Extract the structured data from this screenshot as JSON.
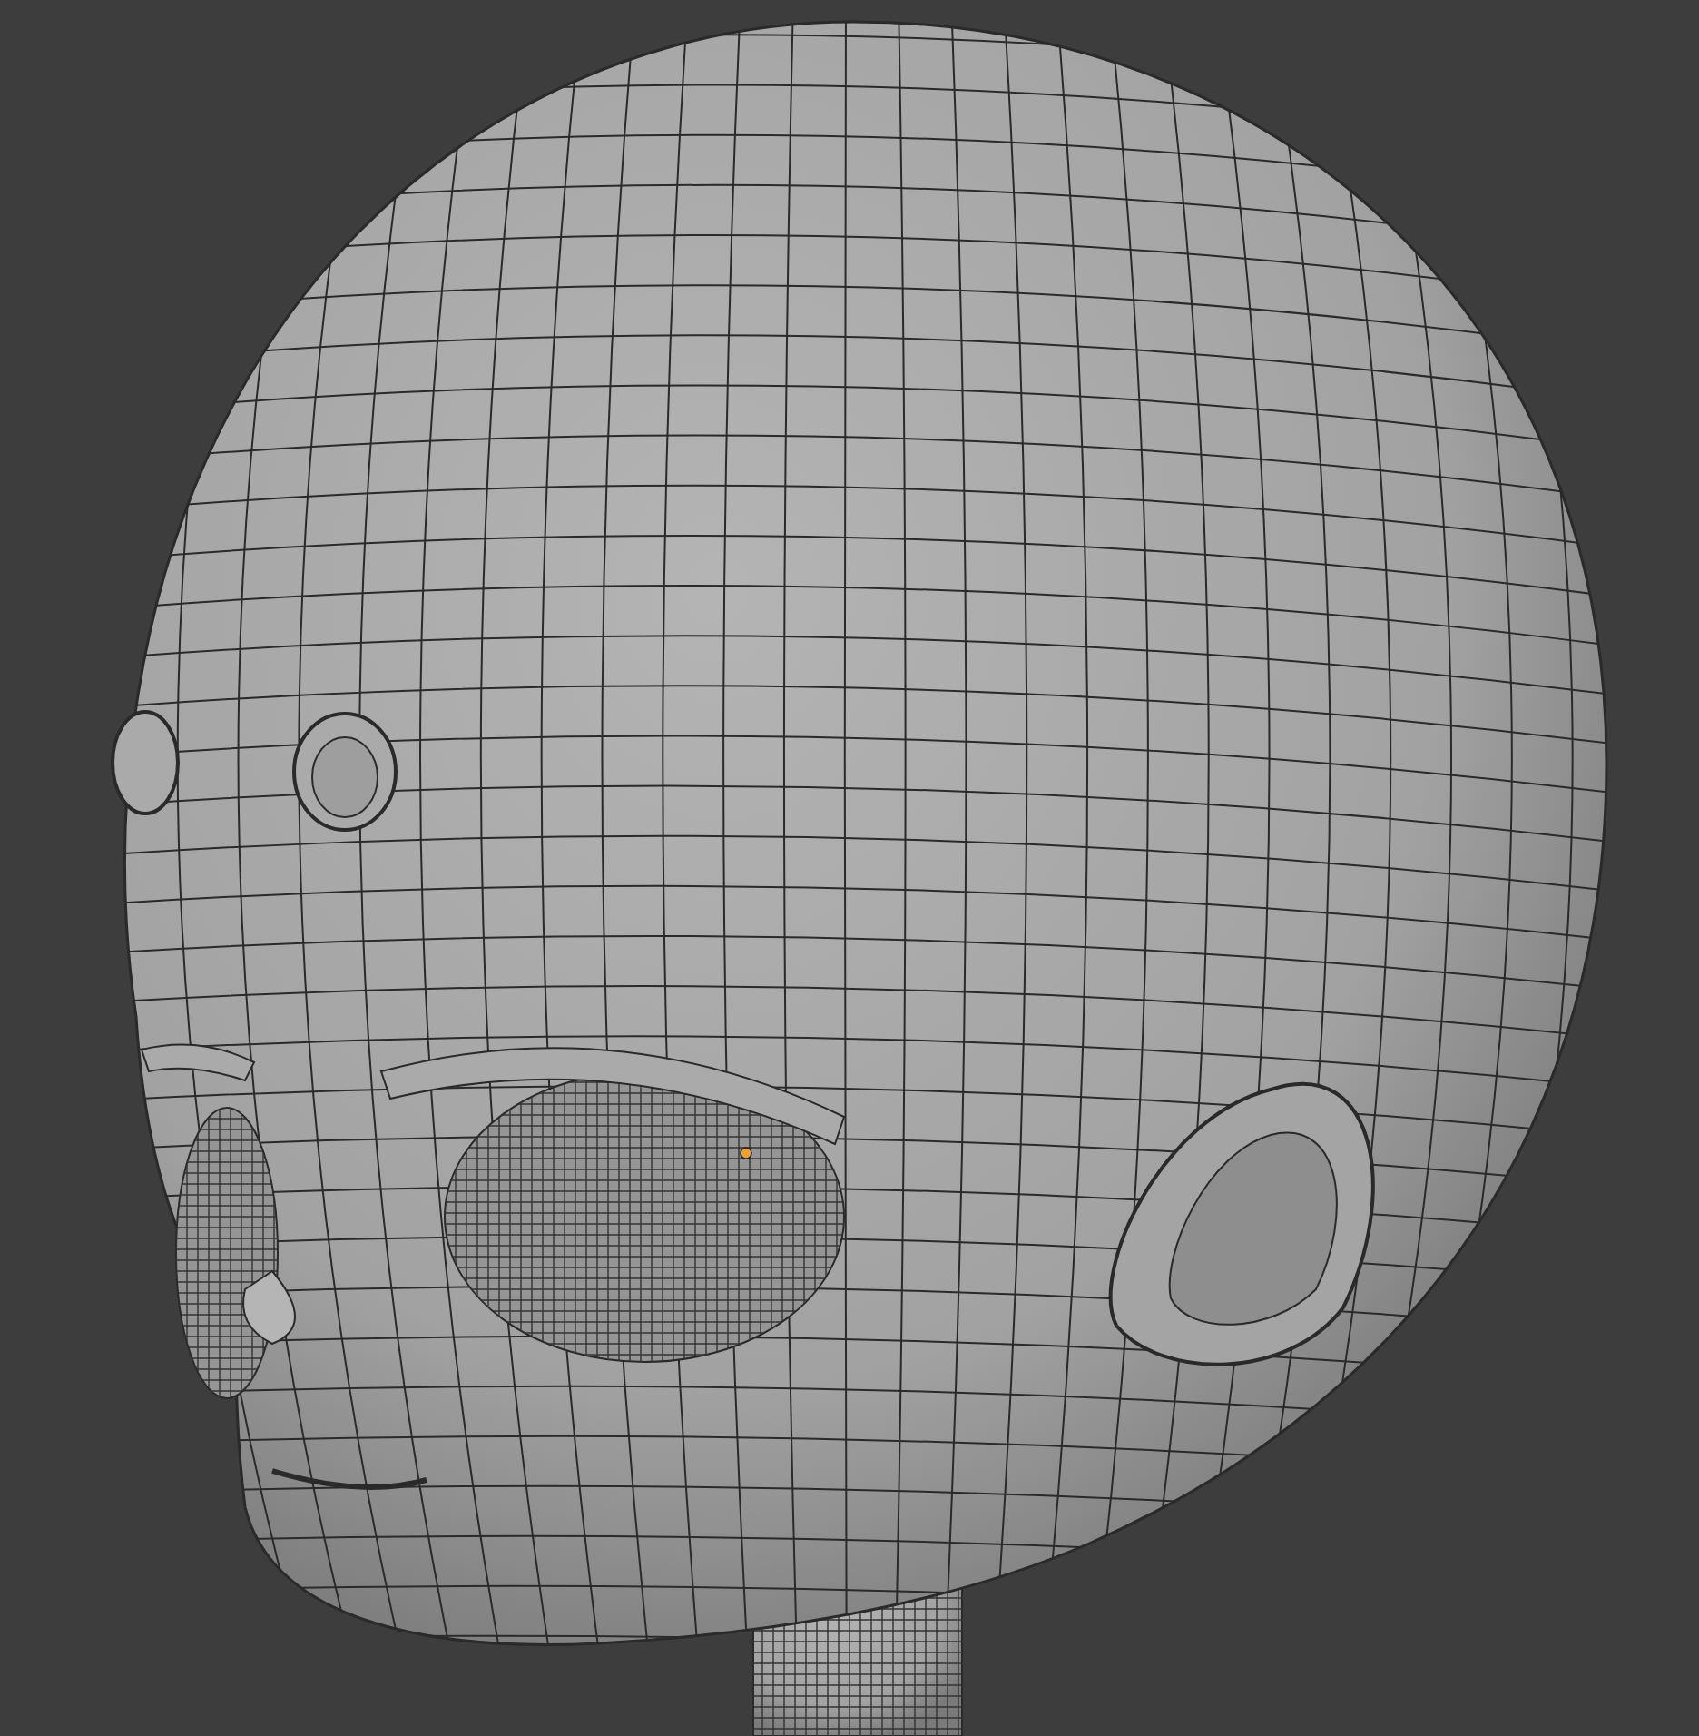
{
  "viewport": {
    "solid_shading": true,
    "wireframe_overlay": true,
    "origin_visible": true
  }
}
